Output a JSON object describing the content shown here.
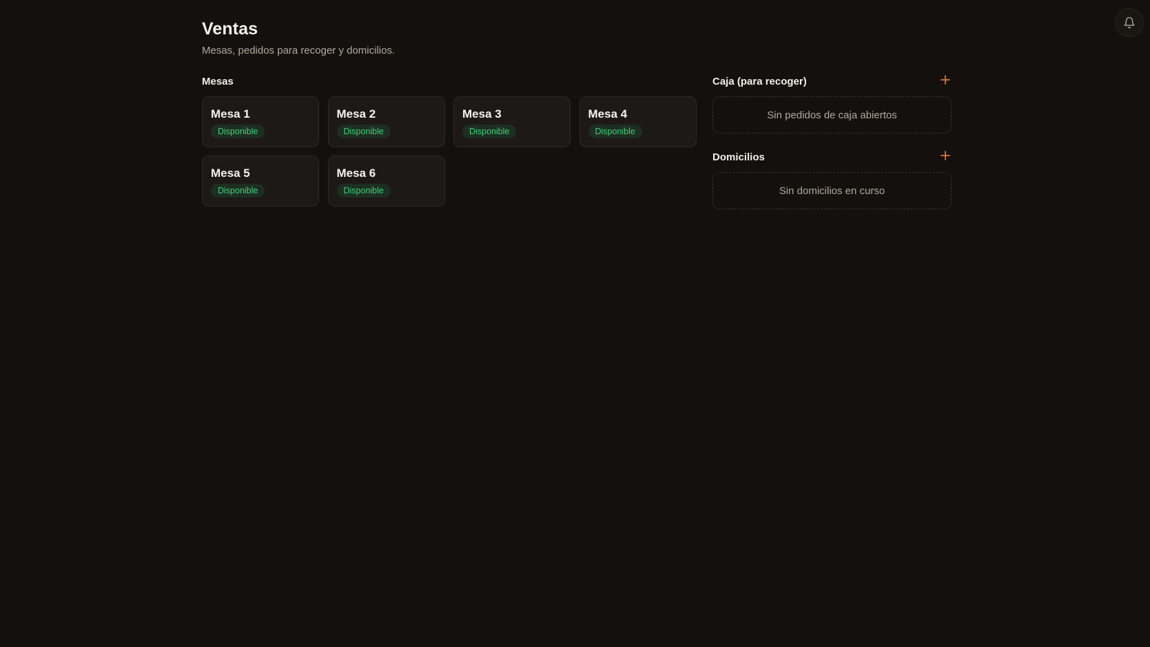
{
  "header": {
    "title": "Ventas",
    "subtitle": "Mesas, pedidos para recoger y domicilios.",
    "notifications_icon": "bell-icon"
  },
  "mesas": {
    "title": "Mesas",
    "items": [
      {
        "name": "Mesa 1",
        "status": "Disponible"
      },
      {
        "name": "Mesa 2",
        "status": "Disponible"
      },
      {
        "name": "Mesa 3",
        "status": "Disponible"
      },
      {
        "name": "Mesa 4",
        "status": "Disponible"
      },
      {
        "name": "Mesa 5",
        "status": "Disponible"
      },
      {
        "name": "Mesa 6",
        "status": "Disponible"
      }
    ]
  },
  "caja": {
    "title": "Caja (para recoger)",
    "add_icon": "plus-icon",
    "empty_text": "Sin pedidos de caja abiertos"
  },
  "domicilios": {
    "title": "Domicilios",
    "add_icon": "plus-icon",
    "empty_text": "Sin domicilios en curso"
  },
  "colors": {
    "background": "#13100d",
    "card": "#1c1916",
    "accent": "#e8752c",
    "status_available": "#3fd27a"
  }
}
